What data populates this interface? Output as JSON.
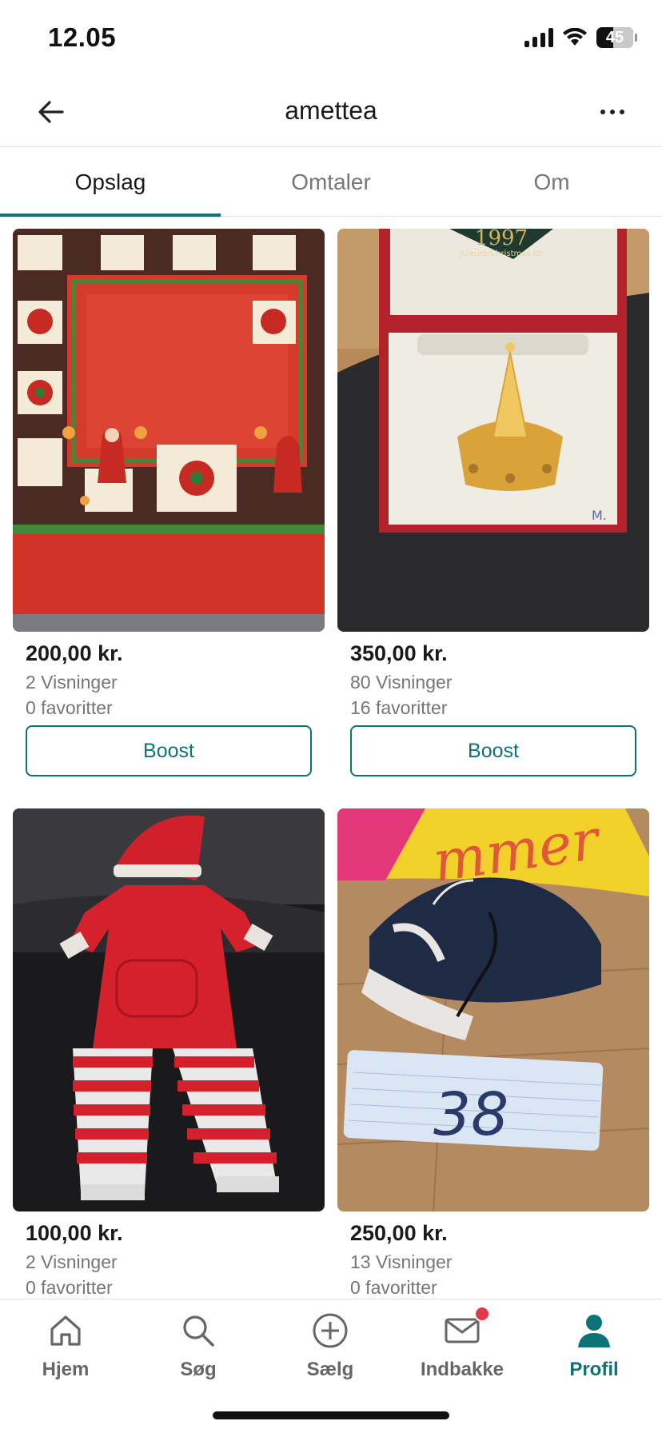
{
  "status_bar": {
    "time": "12.05",
    "battery": "45"
  },
  "header": {
    "title": "amettea",
    "back_icon": "arrow-left-icon",
    "more_icon": "more-horizontal-icon"
  },
  "tabs": [
    {
      "label": "Opslag",
      "active": true
    },
    {
      "label": "Omtaler",
      "active": false
    },
    {
      "label": "Om",
      "active": false
    }
  ],
  "listings": [
    {
      "price": "200,00 kr.",
      "views": "2 Visninger",
      "favorites": "0 favoritter",
      "boost_label": "Boost",
      "image": "red-christmas-tablecloth"
    },
    {
      "price": "350,00 kr.",
      "views": "80 Visninger",
      "favorites": "16 favoritter",
      "boost_label": "Boost",
      "image": "gold-christmas-tree-ornament-in-box",
      "box_label": "1997",
      "box_sub": "Juleuro/Christmas Or"
    },
    {
      "price": "100,00 kr.",
      "views": "2 Visninger",
      "favorites": "0 favoritter",
      "image": "red-striped-santa-outfit"
    },
    {
      "price": "250,00 kr.",
      "views": "13 Visninger",
      "favorites": "0 favoritter",
      "image": "navy-running-shoes",
      "note_text": "38",
      "bag_text": "mmer"
    }
  ],
  "bottom_nav": [
    {
      "label": "Hjem",
      "icon": "home-icon",
      "active": false
    },
    {
      "label": "Søg",
      "icon": "search-icon",
      "active": false
    },
    {
      "label": "Sælg",
      "icon": "plus-circle-icon",
      "active": false
    },
    {
      "label": "Indbakke",
      "icon": "mail-icon",
      "active": false,
      "badge": true
    },
    {
      "label": "Profil",
      "icon": "profile-icon",
      "active": true
    }
  ],
  "colors": {
    "accent": "#0d7377",
    "badge": "#e0394a",
    "muted_text": "#767676"
  }
}
